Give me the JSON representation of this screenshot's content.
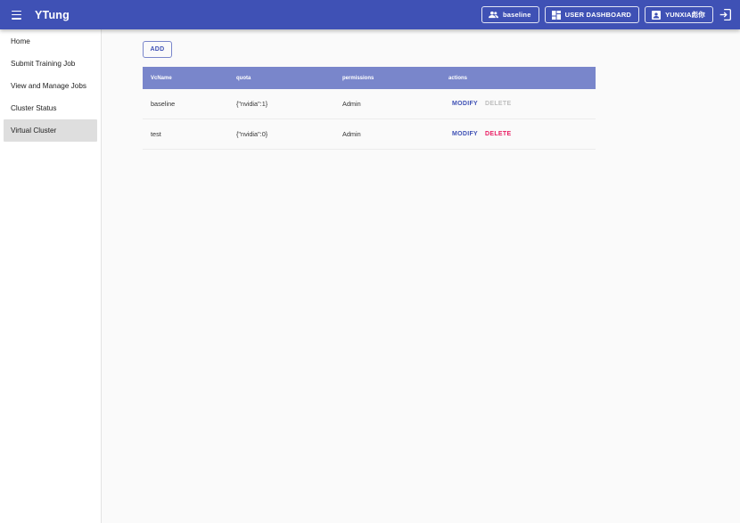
{
  "app": {
    "title": "YTung"
  },
  "header": {
    "team_label": "baseline",
    "dashboard_label": "USER DASHBOARD",
    "user_label": "YUNXIA彪你"
  },
  "sidebar": {
    "items": [
      {
        "label": "Home"
      },
      {
        "label": "Submit Training Job"
      },
      {
        "label": "View and Manage Jobs"
      },
      {
        "label": "Cluster Status"
      },
      {
        "label": "Virtual Cluster"
      }
    ],
    "active_index": 4
  },
  "main": {
    "add_label": "ADD",
    "table": {
      "headers": [
        "VcName",
        "quota",
        "permissions",
        "actions"
      ],
      "rows": [
        {
          "name": "baseline",
          "quota": "{\"nvidia\":1}",
          "permissions": "Admin",
          "modify": "MODIFY",
          "delete": "DELETE",
          "delete_enabled": false
        },
        {
          "name": "test",
          "quota": "{\"nvidia\":0}",
          "permissions": "Admin",
          "modify": "MODIFY",
          "delete": "DELETE",
          "delete_enabled": true
        }
      ]
    }
  },
  "colors": {
    "primary": "#3f51b5",
    "table_header": "#7986cb",
    "delete": "#e91e63",
    "disabled": "#bdbdbd"
  }
}
